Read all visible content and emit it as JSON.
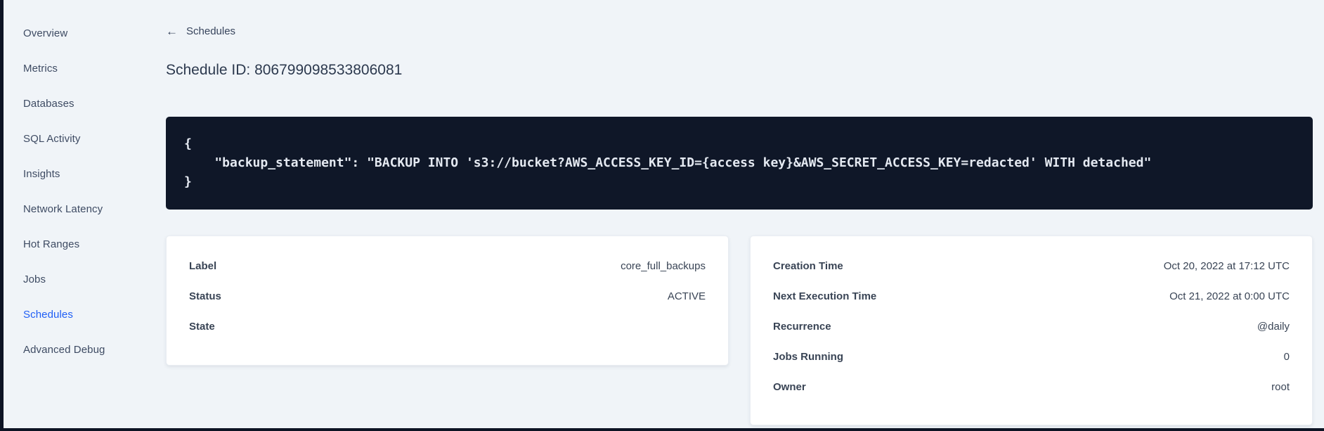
{
  "colors": {
    "page_background": "#f0f4f8",
    "frame_edge": "#0d1424",
    "code_block_background": "#0f1728",
    "code_text": "#e4e9f1",
    "active_nav_blue": "#1f5ef5",
    "card_background": "#ffffff",
    "text_slate": "#394455"
  },
  "sidebar": {
    "items": [
      {
        "label": "Overview",
        "active": false
      },
      {
        "label": "Metrics",
        "active": false
      },
      {
        "label": "Databases",
        "active": false
      },
      {
        "label": "SQL Activity",
        "active": false
      },
      {
        "label": "Insights",
        "active": false
      },
      {
        "label": "Network Latency",
        "active": false
      },
      {
        "label": "Hot Ranges",
        "active": false
      },
      {
        "label": "Jobs",
        "active": false
      },
      {
        "label": "Schedules",
        "active": true
      },
      {
        "label": "Advanced Debug",
        "active": false
      }
    ]
  },
  "main": {
    "back_link_label": "Schedules",
    "back_arrow_glyph": "←",
    "title": "Schedule ID: 806799098533806081",
    "code_block": {
      "lines": [
        "{",
        "    \"backup_statement\": \"BACKUP INTO 's3://bucket?AWS_ACCESS_KEY_ID={access key}&AWS_SECRET_ACCESS_KEY=redacted' WITH detached\"",
        "}"
      ]
    },
    "cards": [
      {
        "name": "summary",
        "rows": [
          {
            "label": "Label",
            "value": "core_full_backups"
          },
          {
            "label": "Status",
            "value": "ACTIVE"
          },
          {
            "label": "State",
            "value": ""
          }
        ]
      },
      {
        "name": "details",
        "rows": [
          {
            "label": "Creation Time",
            "value": "Oct 20, 2022 at 17:12 UTC"
          },
          {
            "label": "Next Execution Time",
            "value": "Oct 21, 2022 at 0:00 UTC"
          },
          {
            "label": "Recurrence",
            "value": "@daily"
          },
          {
            "label": "Jobs Running",
            "value": "0"
          },
          {
            "label": "Owner",
            "value": "root"
          }
        ]
      }
    ]
  }
}
